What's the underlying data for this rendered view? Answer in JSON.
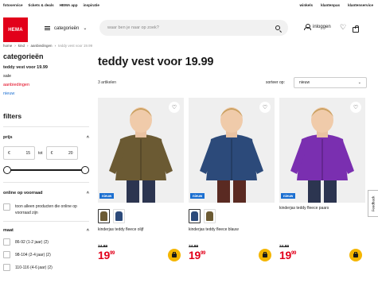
{
  "topbar": {
    "left": [
      "fotoservice",
      "tickets & deals",
      "HEMA app",
      "inspiratie"
    ],
    "right": [
      "winkels",
      "klantenpas",
      "klantenservice"
    ]
  },
  "header": {
    "logo": "HEMA",
    "menu_label": "categorieën",
    "search_placeholder": "waar ben je naar op zoek?",
    "login_label": "inloggen"
  },
  "breadcrumb": [
    "home",
    "kind",
    "aanbiedingen",
    "teddy vest voor 19.99"
  ],
  "sidebar": {
    "title": "categorieën",
    "categories": [
      "teddy vest voor 19.99",
      "sale",
      "aanbiedingen",
      "nieuw"
    ],
    "filters_title": "filters",
    "price_label": "prijs",
    "price_min": "15",
    "price_max": "20",
    "currency": "€",
    "to_label": "tot",
    "price_range_fraction": [
      0,
      1
    ],
    "online_label": "online op voorraad",
    "online_option": "toon alleen producten die online op voorraad zijn",
    "size_label": "maat",
    "sizes": [
      "86-92 (1-2 jaar) (2)",
      "98-104 (2-4 jaar) (2)",
      "110-116 (4-6 jaar) (2)"
    ]
  },
  "main": {
    "title": "teddy vest voor 19.99",
    "count": "3 artikelen",
    "sort_label": "sorteer op:",
    "sort_value": "nieuw"
  },
  "products": [
    {
      "name": "kinderjas teddy fleece olijf",
      "badge": "nieuw",
      "old_price": "24.99",
      "price_main": "19",
      "price_cents": "99",
      "jacket_color": "#6b5a33",
      "swatches": [
        "#6b5a33",
        "#2c4a7a"
      ]
    },
    {
      "name": "kinderjas teddy fleece blauw",
      "badge": "nieuw",
      "old_price": "24.99",
      "price_main": "19",
      "price_cents": "99",
      "jacket_color": "#2c4a7a",
      "swatches": [
        "#2c4a7a",
        "#6b5a33"
      ]
    },
    {
      "name": "kinderjas teddy fleece paars",
      "badge": "nieuw",
      "old_price": "24.99",
      "price_main": "19",
      "price_cents": "99",
      "jacket_color": "#7a2fb0",
      "swatches": []
    }
  ],
  "feedback": "Feedback",
  "colors": {
    "brand": "#e2001a",
    "accent_blue": "#1b6fd1",
    "cart_yellow": "#f5b600"
  }
}
